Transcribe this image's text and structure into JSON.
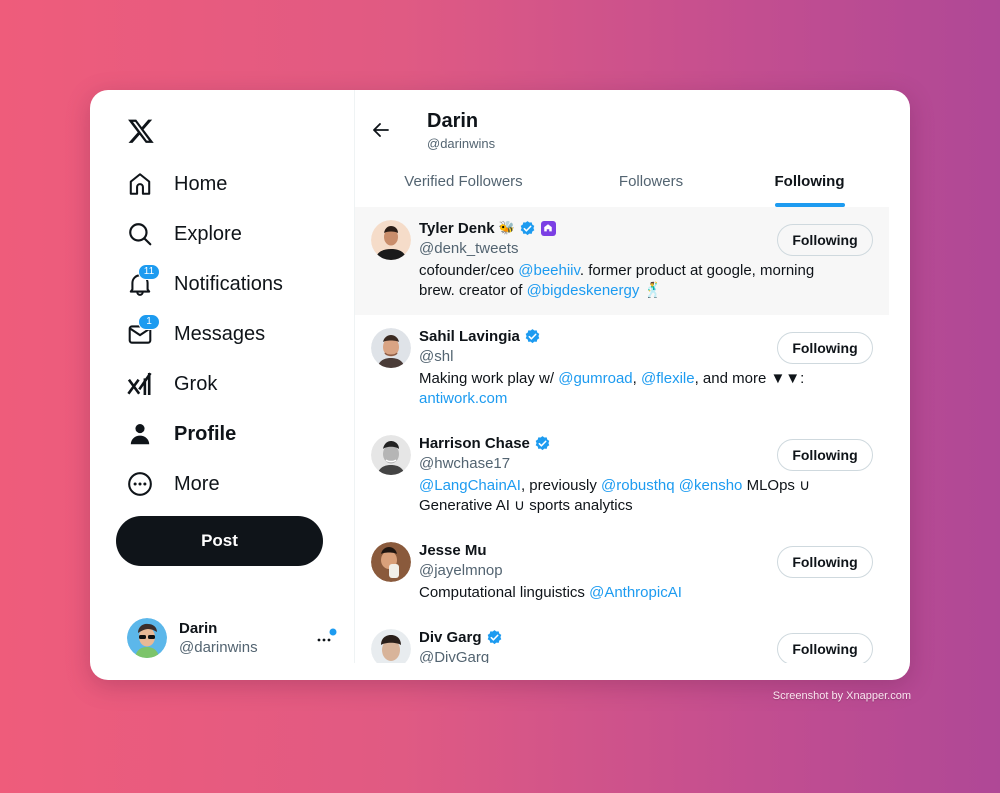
{
  "sidebar": {
    "logo": "x-logo",
    "items": [
      {
        "label": "Home",
        "icon": "home-icon"
      },
      {
        "label": "Explore",
        "icon": "search-icon"
      },
      {
        "label": "Notifications",
        "icon": "bell-icon",
        "badge": "11"
      },
      {
        "label": "Messages",
        "icon": "envelope-icon",
        "badge": "1"
      },
      {
        "label": "Grok",
        "icon": "grok-icon"
      },
      {
        "label": "Profile",
        "icon": "person-icon",
        "active": true
      },
      {
        "label": "More",
        "icon": "more-circle-icon"
      }
    ],
    "post_label": "Post",
    "account": {
      "name": "Darin",
      "handle": "@darinwins"
    }
  },
  "header": {
    "title": "Darin",
    "subtitle": "@darinwins"
  },
  "tabs": [
    {
      "label": "Verified Followers",
      "active": false
    },
    {
      "label": "Followers",
      "active": false
    },
    {
      "label": "Following",
      "active": true
    }
  ],
  "accounts": [
    {
      "name": "Tyler Denk",
      "name_emoji": "🐝",
      "verified": true,
      "handle": "@denk_tweets",
      "bio": [
        {
          "text": "cofounder/ceo "
        },
        {
          "text": "@beehiiv",
          "link": true
        },
        {
          "text": ". former product at google, morning brew. creator of "
        },
        {
          "text": "@bigdeskenergy",
          "link": true
        },
        {
          "text": " 🕺"
        }
      ],
      "button": "Following"
    },
    {
      "name": "Sahil Lavingia",
      "verified": true,
      "handle": "@shl",
      "bio": [
        {
          "text": "Making work play w/ "
        },
        {
          "text": "@gumroad",
          "link": true
        },
        {
          "text": ", "
        },
        {
          "text": "@flexile",
          "link": true
        },
        {
          "text": ", and more ▼▼: "
        },
        {
          "text": "antiwork.com",
          "link": true
        }
      ],
      "button": "Following"
    },
    {
      "name": "Harrison Chase",
      "verified": true,
      "handle": "@hwchase17",
      "bio": [
        {
          "text": "@LangChainAI",
          "link": true
        },
        {
          "text": ", previously "
        },
        {
          "text": "@robusthq",
          "link": true
        },
        {
          "text": " "
        },
        {
          "text": "@kensho",
          "link": true
        },
        {
          "text": " MLOps ∪ Generative AI ∪ sports analytics"
        }
      ],
      "button": "Following"
    },
    {
      "name": "Jesse Mu",
      "verified": false,
      "handle": "@jayelmnop",
      "bio": [
        {
          "text": "Computational linguistics "
        },
        {
          "text": "@AnthropicAI",
          "link": true
        }
      ],
      "button": "Following"
    },
    {
      "name": "Div Garg",
      "verified": true,
      "handle": "@DivGarg",
      "bio": [],
      "button": "Following"
    }
  ],
  "colors": {
    "accent": "#1d9bf0",
    "text": "#0f1419",
    "muted": "#536471"
  },
  "watermark": "Screenshot by Xnapper.com"
}
